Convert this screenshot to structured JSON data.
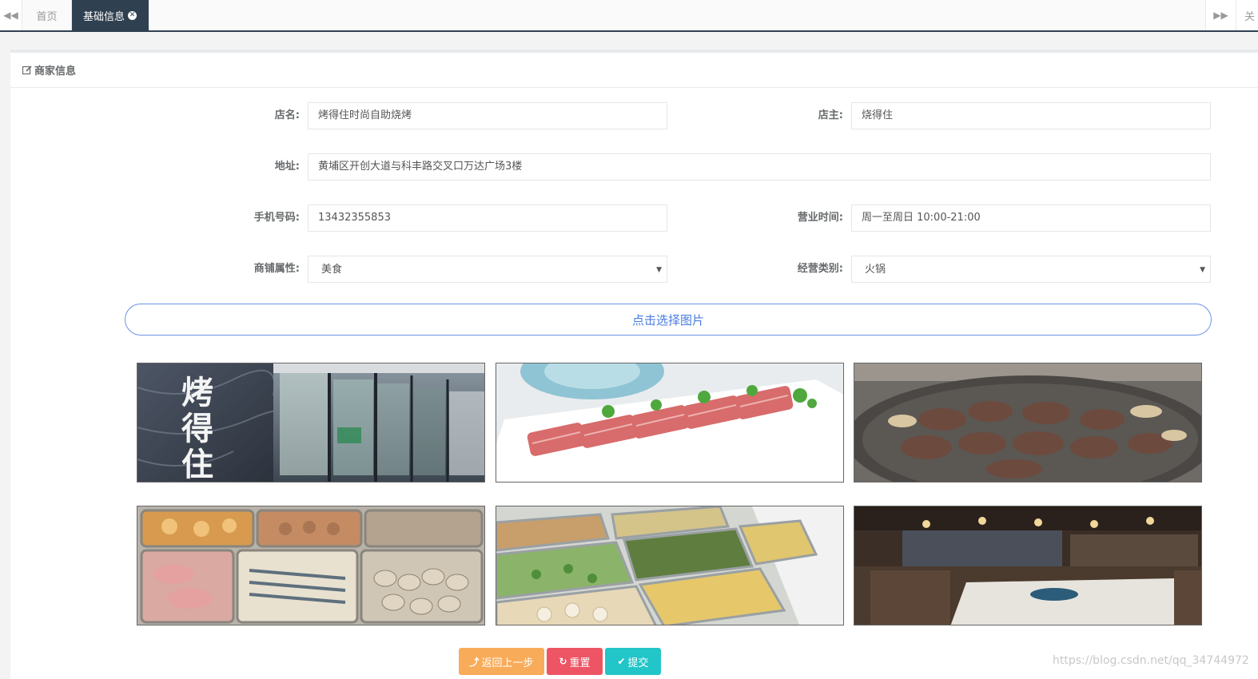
{
  "tabs": {
    "home_label": "首页",
    "active_label": "基础信息",
    "close_all_label": "关"
  },
  "panel": {
    "title": "商家信息"
  },
  "form": {
    "shop_name_label": "店名:",
    "shop_name_value": "烤得住时尚自助烧烤",
    "owner_label": "店主:",
    "owner_value": "烧得住",
    "address_label": "地址:",
    "address_value": "黄埔区开创大道与科丰路交叉口万达广场3楼",
    "phone_label": "手机号码:",
    "phone_value": "13432355853",
    "hours_label": "营业时间:",
    "hours_value": "周一至周日 10:00-21:00",
    "attr_label": "商铺属性:",
    "attr_value": "美食",
    "category_label": "经营类别:",
    "category_value": "火锅"
  },
  "images": {
    "pick_label": "点击选择图片",
    "shop_sign_text": "烤得住"
  },
  "actions": {
    "back_label": "返回上一步",
    "reset_label": "重置",
    "submit_label": "提交"
  },
  "watermark": "https://blog.csdn.net/qq_34744972",
  "colors": {
    "nav_dark": "#2f4050",
    "back": "#f8ac59",
    "reset": "#ed5565",
    "submit": "#23c6c8",
    "pick_border": "#6a93e8"
  }
}
